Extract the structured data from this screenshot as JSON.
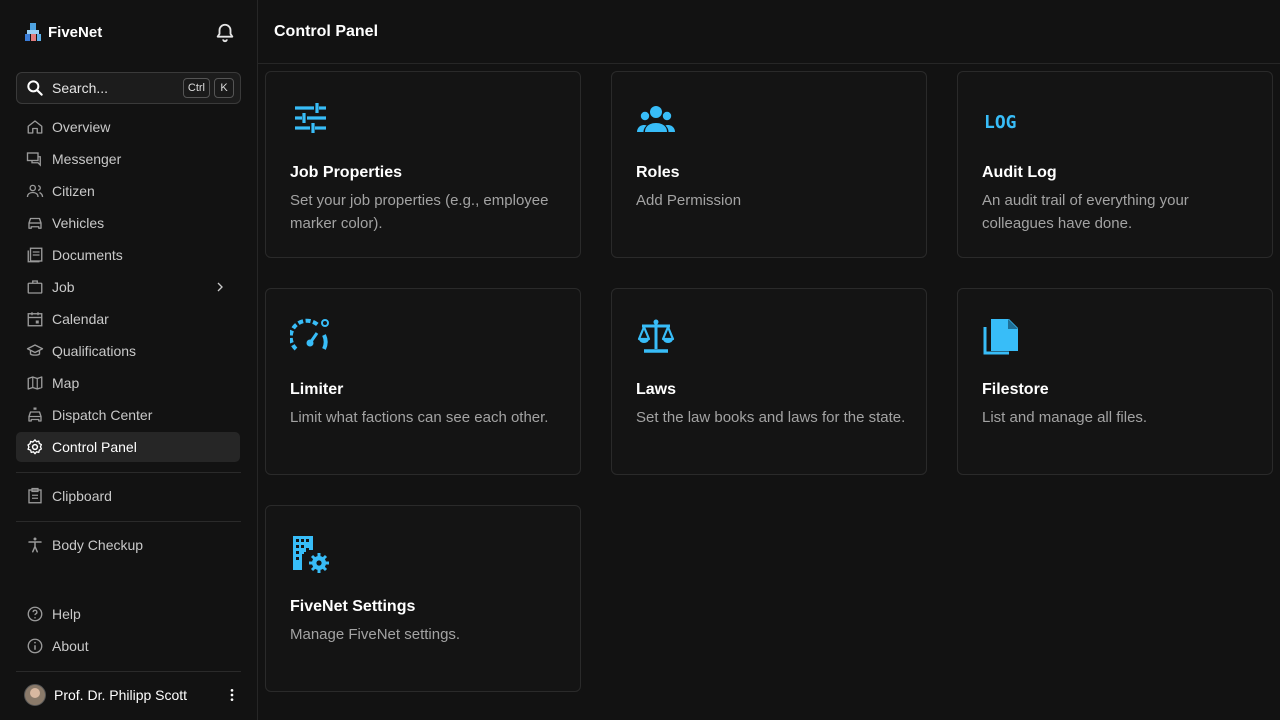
{
  "brand": {
    "name": "FiveNet"
  },
  "search": {
    "placeholder": "Search...",
    "key1": "Ctrl",
    "key2": "K"
  },
  "nav": [
    {
      "label": "Overview",
      "icon": "home-icon"
    },
    {
      "label": "Messenger",
      "icon": "chat-icon"
    },
    {
      "label": "Citizen",
      "icon": "users-icon"
    },
    {
      "label": "Vehicles",
      "icon": "car-icon"
    },
    {
      "label": "Documents",
      "icon": "document-icon"
    },
    {
      "label": "Job",
      "icon": "briefcase-icon"
    },
    {
      "label": "Calendar",
      "icon": "calendar-icon"
    },
    {
      "label": "Qualifications",
      "icon": "school-icon"
    },
    {
      "label": "Map",
      "icon": "map-icon"
    },
    {
      "label": "Dispatch Center",
      "icon": "car-siren-icon"
    },
    {
      "label": "Control Panel",
      "icon": "cog-icon"
    }
  ],
  "nav_secondary": [
    {
      "label": "Clipboard",
      "icon": "clipboard-icon"
    },
    {
      "label": "Body Checkup",
      "icon": "human-icon"
    }
  ],
  "nav_footer": [
    {
      "label": "Help",
      "icon": "help-icon"
    },
    {
      "label": "About",
      "icon": "info-icon"
    }
  ],
  "user": {
    "name": "Prof. Dr. Philipp Scott"
  },
  "header": {
    "title": "Control Panel"
  },
  "colors": {
    "accent": "#38bdf8",
    "background": "#121212",
    "card": "#141414"
  },
  "cards": [
    {
      "title": "Job Properties",
      "description": "Set your job properties (e.g., employee marker color).",
      "icon": "tune-icon"
    },
    {
      "title": "Roles",
      "description": "Add Permission",
      "icon": "account-group-icon"
    },
    {
      "title": "Audit Log",
      "description": "An audit trail of everything your colleagues have done.",
      "icon": "log-icon",
      "icon_text": "LOG"
    },
    {
      "title": "Limiter",
      "description": "Limit what factions can see each other.",
      "icon": "speedometer-icon"
    },
    {
      "title": "Laws",
      "description": "Set the law books and laws for the state.",
      "icon": "scale-balance-icon"
    },
    {
      "title": "Filestore",
      "description": "List and manage all files.",
      "icon": "file-icon"
    },
    {
      "title": "FiveNet Settings",
      "description": "Manage FiveNet settings.",
      "icon": "office-building-cog-icon"
    }
  ]
}
